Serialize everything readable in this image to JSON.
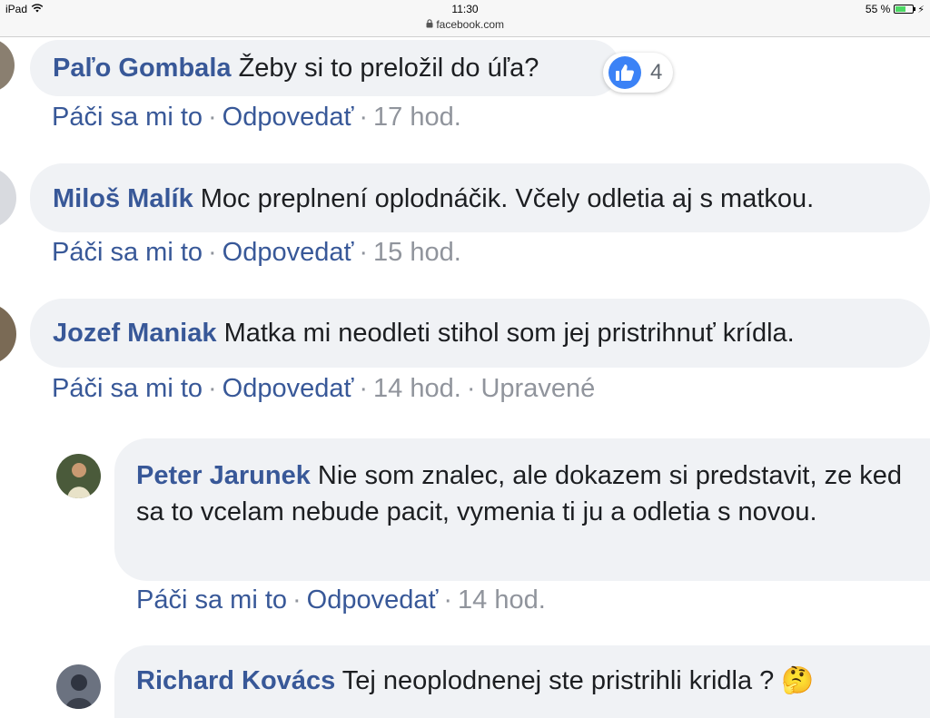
{
  "statusbar": {
    "device": "iPad",
    "time": "11:30",
    "url": "facebook.com",
    "battery": "55 %"
  },
  "comments": [
    {
      "author": "Paľo Gombala",
      "text": "Žeby si to preložil do úľa?",
      "reactions_count": "4",
      "like": "Páči sa mi to",
      "reply": "Odpovedať",
      "time": "17 hod."
    },
    {
      "author": "Miloš Malík",
      "text": "Moc preplnení oplodnáčik. Včely odletia aj s matkou.",
      "like": "Páči sa mi to",
      "reply": "Odpovedať",
      "time": "15 hod."
    },
    {
      "author": "Jozef Maniak",
      "text": "Matka mi neodleti stihol som jej pristrihnuť krídla.",
      "like": "Páči sa mi to",
      "reply": "Odpovedať",
      "time": "14 hod.",
      "edited": "Upravené"
    }
  ],
  "replies": [
    {
      "author": "Peter Jarunek",
      "text": "Nie som znalec, ale dokazem si predstavit, ze ked sa to vcelam nebude pacit, vymenia ti ju a odletia s novou.",
      "like": "Páči sa mi to",
      "reply": "Odpovedať",
      "time": "14 hod."
    },
    {
      "author": "Richard Kovács",
      "text": "Tej neoplodnenej ste pristrihli kridla ? 🤔"
    }
  ],
  "separator": "·",
  "colors": {
    "link": "#385898",
    "bubble": "#f0f2f5",
    "muted": "#90949c",
    "like_blue": "#3b82f6"
  },
  "icons": {
    "wifi": "wifi-icon",
    "lock": "lock-icon",
    "battery": "battery-icon",
    "like": "thumbs-up-icon"
  }
}
